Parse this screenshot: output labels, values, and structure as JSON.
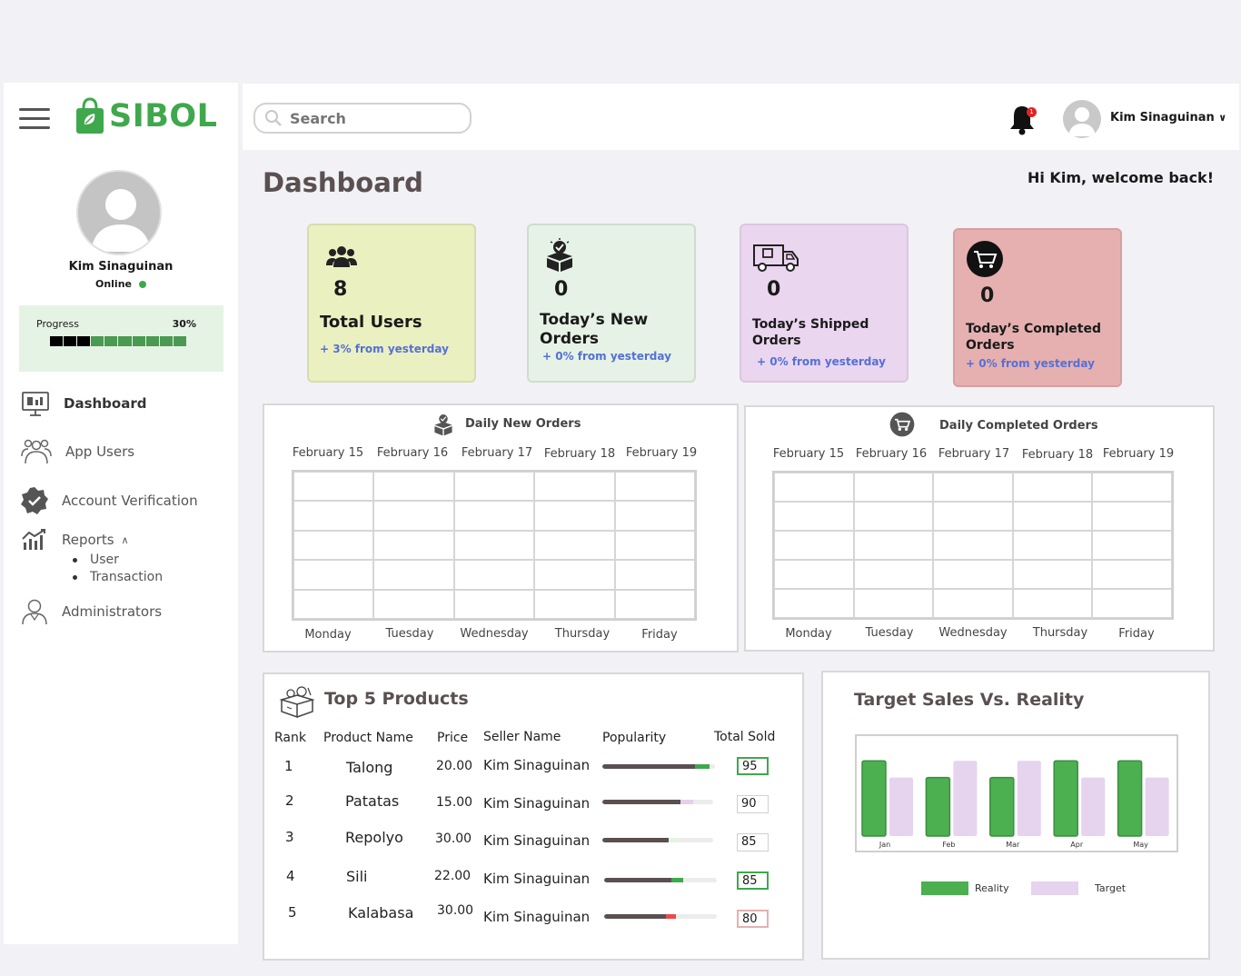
{
  "brand": {
    "name": "SIBOL",
    "color": "#3fa84d"
  },
  "sidebar": {
    "user_name": "Kim Sinaguinan",
    "status": "Online",
    "progress": {
      "label": "Progress",
      "percent_text": "30%",
      "value": 0.3
    },
    "nav": [
      {
        "label": "Dashboard",
        "icon": "dashboard-icon",
        "active": true
      },
      {
        "label": "App Users",
        "icon": "users-icon"
      },
      {
        "label": "Account Verification",
        "icon": "verified-badge-icon"
      },
      {
        "label": "Reports",
        "icon": "reports-chart-icon",
        "expanded": true,
        "children": [
          "User",
          "Transaction"
        ]
      },
      {
        "label": "Administrators",
        "icon": "admin-user-icon"
      }
    ]
  },
  "topbar": {
    "search_placeholder": "Search",
    "notification_count": "1",
    "user_name": "Kim Sinaguinan"
  },
  "main": {
    "title": "Dashboard",
    "welcome": "Hi Kim, welcome  back!",
    "stats": [
      {
        "value": "8",
        "title": "Total Users",
        "change": "+ 3% from yesterday",
        "bg": "#eaf0c0",
        "icon": "users-group-icon"
      },
      {
        "value": "0",
        "title": "Today’s New Orders",
        "change": "+ 0% from yesterday",
        "bg": "#e6f2e6",
        "icon": "new-order-box-icon"
      },
      {
        "value": "0",
        "title": "Today’s Shipped Orders",
        "change": "+ 0% from yesterday",
        "bg": "#ead6ef",
        "icon": "delivery-truck-icon"
      },
      {
        "value": "0",
        "title": "Today’s Completed Orders",
        "change": "+ 0% from yesterday",
        "bg": "#e6b0b0",
        "icon": "cart-circle-icon"
      }
    ],
    "daily_new_orders": {
      "title": "Daily New Orders",
      "dates": [
        "February 15",
        "February 16",
        "February 17",
        "February 18",
        "February 19"
      ],
      "days": [
        "Monday",
        "Tuesday",
        "Wednesday",
        "Thursday",
        "Friday"
      ]
    },
    "daily_completed_orders": {
      "title": "Daily Completed Orders",
      "dates": [
        "February 15",
        "February 16",
        "February 17",
        "February 18",
        "February 19"
      ],
      "days": [
        "Monday",
        "Tuesday",
        "Wednesday",
        "Thursday",
        "Friday"
      ]
    },
    "top_products": {
      "title": "Top 5 Products",
      "headers": [
        "Rank",
        "Product Name",
        "Price",
        "Seller Name",
        "Popularity",
        "Total Sold"
      ],
      "rows": [
        {
          "rank": "1",
          "name": "Talong",
          "price": "20.00",
          "seller": "Kim Sinaguinan",
          "popularity": 0.95,
          "tail": "#3fa84d",
          "sold": "95",
          "highlight": "#3fa84d"
        },
        {
          "rank": "2",
          "name": "Patatas",
          "price": "15.00",
          "seller": "Kim Sinaguinan",
          "popularity": 0.82,
          "tail": "#e6cfee",
          "sold": "90",
          "highlight": "#d0d0d0"
        },
        {
          "rank": "3",
          "name": "Repolyo",
          "price": "30.00",
          "seller": "Kim Sinaguinan",
          "popularity": 0.7,
          "tail": "#e6f2e6",
          "sold": "85",
          "highlight": "#d0d0d0"
        },
        {
          "rank": "4",
          "name": "Sili",
          "price": "22.00",
          "seller": "Kim Sinaguinan",
          "popularity": 0.7,
          "tail": "#3fa84d",
          "sold": "85",
          "highlight": "#3fa84d"
        },
        {
          "rank": "5",
          "name": "Kalabasa",
          "price": "30.00",
          "seller": "Kim Sinaguinan",
          "popularity": 0.64,
          "tail": "#e84b4b",
          "sold": "80",
          "highlight": "#e6b0b0"
        }
      ]
    }
  },
  "chart_data": {
    "type": "bar",
    "title": "Target Sales Vs. Reality",
    "categories": [
      "Jan",
      "Feb",
      "Mar",
      "Apr",
      "May"
    ],
    "series": [
      {
        "name": "Reality",
        "color": "#4caf50",
        "values": [
          90,
          70,
          70,
          90,
          90
        ]
      },
      {
        "name": "Target",
        "color": "#e6d3ee",
        "values": [
          70,
          90,
          90,
          70,
          70
        ]
      }
    ],
    "ylim": [
      0,
      100
    ],
    "legend": "bottom"
  }
}
